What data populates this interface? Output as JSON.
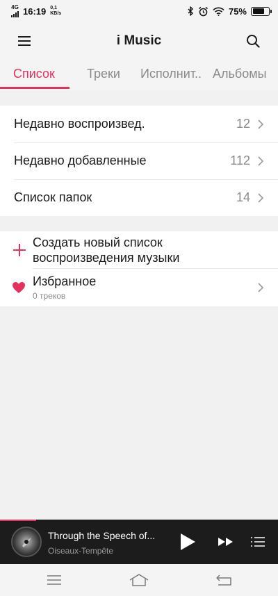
{
  "status_bar": {
    "network": "4G",
    "time": "16:19",
    "speed_value": "0,1",
    "speed_unit": "KB/s",
    "battery_percent": "75%",
    "battery_level": 0.75,
    "icons": [
      "bluetooth-icon",
      "alarm-icon",
      "wifi-icon",
      "battery-icon"
    ]
  },
  "app_bar": {
    "title": "i Music",
    "left_icon": "menu-icon",
    "right_icon": "search-icon"
  },
  "tabs": [
    {
      "label": "Список",
      "active": true
    },
    {
      "label": "Треки",
      "active": false
    },
    {
      "label": "Исполнит..",
      "active": false
    },
    {
      "label": "Альбомы",
      "active": false
    }
  ],
  "accent_color": "#e5325c",
  "lists": [
    {
      "label": "Недавно воспроизвед.",
      "count": "12"
    },
    {
      "label": "Недавно добавленные",
      "count": "112"
    },
    {
      "label": "Список папок",
      "count": "14"
    }
  ],
  "playlists": {
    "create_line1": "Создать новый список",
    "create_line2": "воспроизведения музыки",
    "favorites_title": "Избранное",
    "favorites_subtitle": "0 треков"
  },
  "player": {
    "title": "Through the Speech of...",
    "artist": "Oiseaux-Tempête",
    "progress": 0.13,
    "controls": [
      "play-icon",
      "next-icon",
      "queue-icon"
    ]
  },
  "nav_bar": [
    "menu-icon",
    "home-icon",
    "back-icon"
  ]
}
